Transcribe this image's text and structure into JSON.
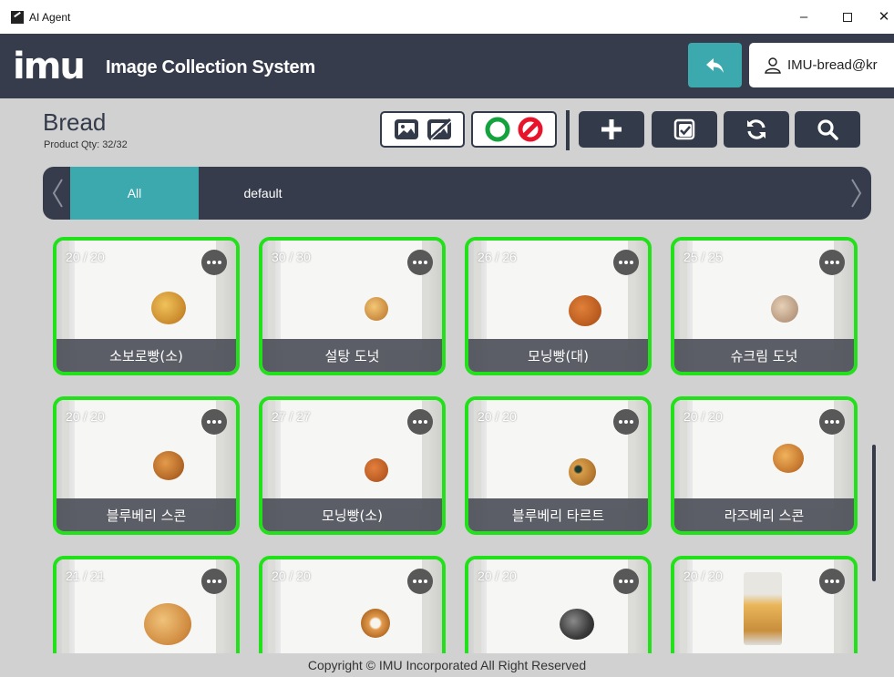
{
  "window": {
    "title": "AI Agent",
    "minimize": "–",
    "close": "✕"
  },
  "header": {
    "logo": "imu",
    "title": "Image Collection System",
    "user_label": "IMU-bread@kr",
    "accent": "#3ba9ad",
    "bg": "#363c4b"
  },
  "category": {
    "title": "Bread",
    "qty": "Product Qty: 32/32"
  },
  "tabs": [
    {
      "label": "All",
      "active": true
    },
    {
      "label": "default",
      "active": false
    }
  ],
  "toolbar": {
    "icons": [
      "image-icon",
      "no-image-icon",
      "circle-ok-icon",
      "ban-icon",
      "plus-icon",
      "checkbox-icon",
      "refresh-icon",
      "search-icon"
    ]
  },
  "products": [
    {
      "count": "20 / 20",
      "name": "소보로빵(소)"
    },
    {
      "count": "30 / 30",
      "name": "설탕 도넛"
    },
    {
      "count": "26 / 26",
      "name": "모닝빵(대)"
    },
    {
      "count": "25 / 25",
      "name": "슈크림 도넛"
    },
    {
      "count": "20 / 20",
      "name": "블루베리 스콘"
    },
    {
      "count": "27 / 27",
      "name": "모닝빵(소)"
    },
    {
      "count": "20 / 20",
      "name": "블루베리 타르트"
    },
    {
      "count": "20 / 20",
      "name": "라즈베리 스콘"
    },
    {
      "count": "21 / 21",
      "name": ""
    },
    {
      "count": "20 / 20",
      "name": ""
    },
    {
      "count": "20 / 20",
      "name": ""
    },
    {
      "count": "20 / 20",
      "name": ""
    }
  ],
  "footer": {
    "text": "Copyright © IMU Incorporated All Right Reserved"
  },
  "colors": {
    "card_border": "#22e01a",
    "content_bg": "#d1d1d1"
  }
}
